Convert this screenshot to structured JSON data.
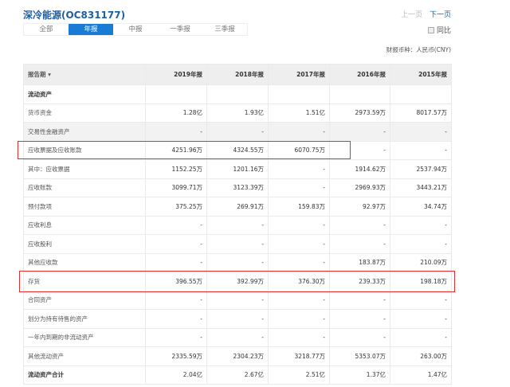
{
  "title": "深冷能源(OC831177)",
  "pager": {
    "prev": "上一页",
    "next": "下一页"
  },
  "tabs": [
    "全部",
    "年报",
    "中报",
    "一季报",
    "三季报"
  ],
  "yoy_label": "同比",
  "currency": "财报币种：人民币(CNY)",
  "table": {
    "header": [
      "报告期 ▾",
      "2019年报",
      "2018年报",
      "2017年报",
      "2016年报",
      "2015年报"
    ],
    "rows": [
      [
        "流动资产",
        "",
        "",
        "",
        "",
        ""
      ],
      [
        "货币资金",
        "1.28亿",
        "1.93亿",
        "1.51亿",
        "2973.59万",
        "8017.57万"
      ],
      [
        "交易性金融资产",
        "-",
        "-",
        "-",
        "-",
        "-"
      ],
      [
        "应收票据及应收账款",
        "4251.96万",
        "4324.55万",
        "6070.75万",
        "-",
        "-"
      ],
      [
        "其中：应收票据",
        "1152.25万",
        "1201.16万",
        "-",
        "1914.62万",
        "2537.94万"
      ],
      [
        "应收账款",
        "3099.71万",
        "3123.39万",
        "-",
        "2969.93万",
        "3443.21万"
      ],
      [
        "预付款项",
        "375.25万",
        "269.91万",
        "159.83万",
        "92.97万",
        "34.74万"
      ],
      [
        "应收利息",
        "-",
        "-",
        "-",
        "-",
        "-"
      ],
      [
        "应收股利",
        "-",
        "-",
        "-",
        "-",
        "-"
      ],
      [
        "其他应收款",
        "-",
        "-",
        "-",
        "183.87万",
        "210.09万"
      ],
      [
        "存货",
        "396.55万",
        "392.99万",
        "376.30万",
        "239.33万",
        "198.18万"
      ],
      [
        "合同资产",
        "-",
        "-",
        "-",
        "-",
        "-"
      ],
      [
        "划分为持有待售的资产",
        "-",
        "-",
        "-",
        "-",
        "-"
      ],
      [
        "一年内到期的非流动资产",
        "-",
        "-",
        "-",
        "-",
        "-"
      ],
      [
        "其他流动资产",
        "2335.59万",
        "2304.23万",
        "3218.77万",
        "5353.07万",
        "263.00万"
      ],
      [
        "流动资产合计",
        "2.04亿",
        "2.67亿",
        "2.51亿",
        "1.37亿",
        "1.47亿"
      ]
    ]
  },
  "colors": {
    "accent": "#1a7bd4",
    "highlight_box": "#e03030"
  }
}
